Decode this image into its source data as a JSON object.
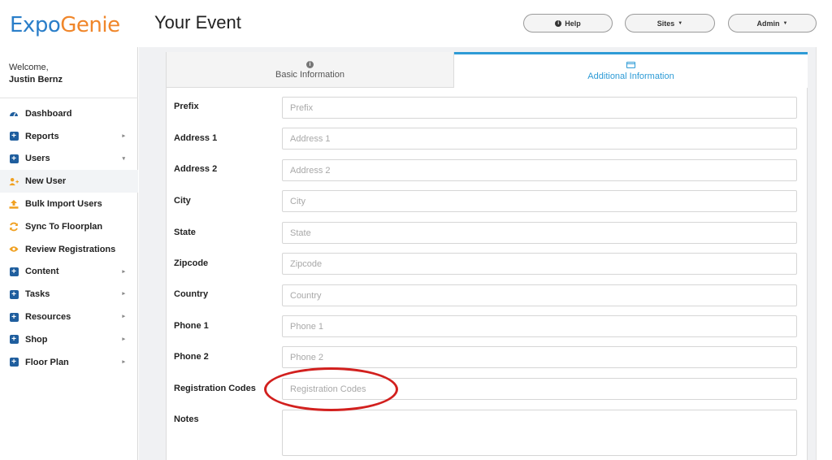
{
  "header": {
    "logo_part1": "Expo",
    "logo_part2": "Genie",
    "title": "Your Event",
    "help_label": "Help",
    "sites_label": "Sites",
    "admin_label": "Admin"
  },
  "sidebar": {
    "welcome": "Welcome,",
    "user_name": "Justin Bernz",
    "items": [
      {
        "label": "Dashboard",
        "icon": "dashboard-icon"
      },
      {
        "label": "Reports",
        "icon": "plus-square-icon",
        "chevron": "right"
      },
      {
        "label": "Users",
        "icon": "plus-square-icon",
        "chevron": "down"
      },
      {
        "label": "New User",
        "icon": "add-user-icon",
        "active": true
      },
      {
        "label": "Bulk Import Users",
        "icon": "upload-icon"
      },
      {
        "label": "Sync To Floorplan",
        "icon": "sync-icon"
      },
      {
        "label": "Review Registrations",
        "icon": "eye-icon"
      },
      {
        "label": "Content",
        "icon": "plus-square-icon",
        "chevron": "right"
      },
      {
        "label": "Tasks",
        "icon": "plus-square-icon",
        "chevron": "right"
      },
      {
        "label": "Resources",
        "icon": "plus-square-icon",
        "chevron": "right"
      },
      {
        "label": "Shop",
        "icon": "plus-square-icon",
        "chevron": "right"
      },
      {
        "label": "Floor Plan",
        "icon": "plus-square-icon",
        "chevron": "right"
      }
    ]
  },
  "tabs": {
    "basic": "Basic Information",
    "additional": "Additional Information"
  },
  "form": {
    "fields": [
      {
        "label": "Prefix",
        "placeholder": "Prefix"
      },
      {
        "label": "Address 1",
        "placeholder": "Address 1"
      },
      {
        "label": "Address 2",
        "placeholder": "Address 2"
      },
      {
        "label": "City",
        "placeholder": "City"
      },
      {
        "label": "State",
        "placeholder": "State"
      },
      {
        "label": "Zipcode",
        "placeholder": "Zipcode"
      },
      {
        "label": "Country",
        "placeholder": "Country"
      },
      {
        "label": "Phone 1",
        "placeholder": "Phone 1"
      },
      {
        "label": "Phone 2",
        "placeholder": "Phone 2"
      },
      {
        "label": "Registration Codes",
        "placeholder": "Registration Codes"
      },
      {
        "label": "Notes",
        "placeholder": ""
      }
    ]
  },
  "colors": {
    "brand_blue": "#2a7ec9",
    "brand_orange": "#f0862a",
    "active_tab": "#2e9bd6",
    "annotation_red": "#d2201e",
    "nav_plus": "#1f5e9e",
    "nav_orange_icons": "#f0a020"
  }
}
